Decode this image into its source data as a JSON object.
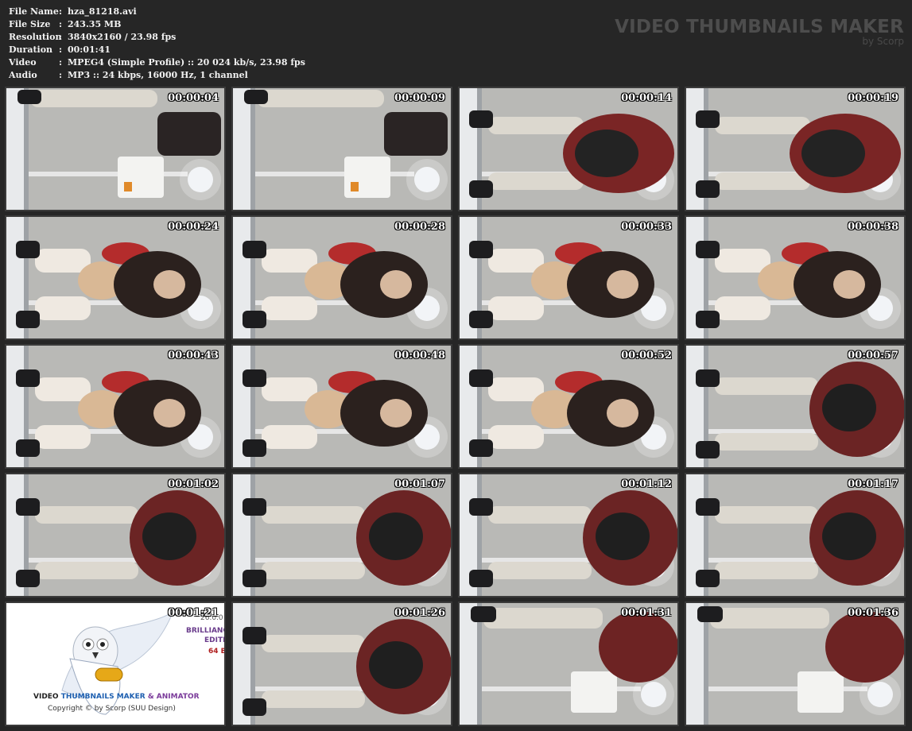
{
  "metadata": {
    "rows": [
      {
        "key": "File Name",
        "sep": ":",
        "value": "hza_81218.avi"
      },
      {
        "key": "File Size",
        "sep": ":",
        "value": "243.35 MB"
      },
      {
        "key": "Resolution",
        "sep": ":",
        "value": "3840x2160 / 23.98 fps"
      },
      {
        "key": "Duration",
        "sep": ":",
        "value": "00:01:41"
      },
      {
        "key": "Video",
        "sep": ":",
        "value": "MPEG4 (Simple Profile) :: 20 024 kb/s, 23.98 fps"
      },
      {
        "key": "Audio",
        "sep": ":",
        "value": "MP3 :: 24 kbps, 16000 Hz, 1 channel"
      }
    ]
  },
  "brand": {
    "title": "VIDEO THUMBNAILS MAKER",
    "subtitle": "by Scorp"
  },
  "thumbnails": [
    {
      "time": "00:00:04"
    },
    {
      "time": "00:00:09"
    },
    {
      "time": "00:00:14"
    },
    {
      "time": "00:00:19"
    },
    {
      "time": "00:00:24"
    },
    {
      "time": "00:00:28"
    },
    {
      "time": "00:00:33"
    },
    {
      "time": "00:00:38"
    },
    {
      "time": "00:00:43"
    },
    {
      "time": "00:00:48"
    },
    {
      "time": "00:00:52"
    },
    {
      "time": "00:00:57"
    },
    {
      "time": "00:01:02"
    },
    {
      "time": "00:01:07"
    },
    {
      "time": "00:01:12"
    },
    {
      "time": "00:01:17"
    },
    {
      "time": "00:01:21"
    },
    {
      "time": "00:01:26"
    },
    {
      "time": "00:01:31"
    },
    {
      "time": "00:01:36"
    }
  ],
  "logo_tile": {
    "version": "26.0.0",
    "edition_line1": "BRILLIANC",
    "edition_line2": "EDITIO",
    "bits": "64 BI",
    "product_part1": "VIDEO ",
    "product_part2": "THUMBNAILS MAKER",
    "product_part3": " & ANIMATOR",
    "copyright": "Copyright © by Scorp (SUU Design)"
  },
  "colors": {
    "background": "#262626",
    "header_text": "#f2f2f2",
    "brand_text": "#4d4d4d"
  }
}
